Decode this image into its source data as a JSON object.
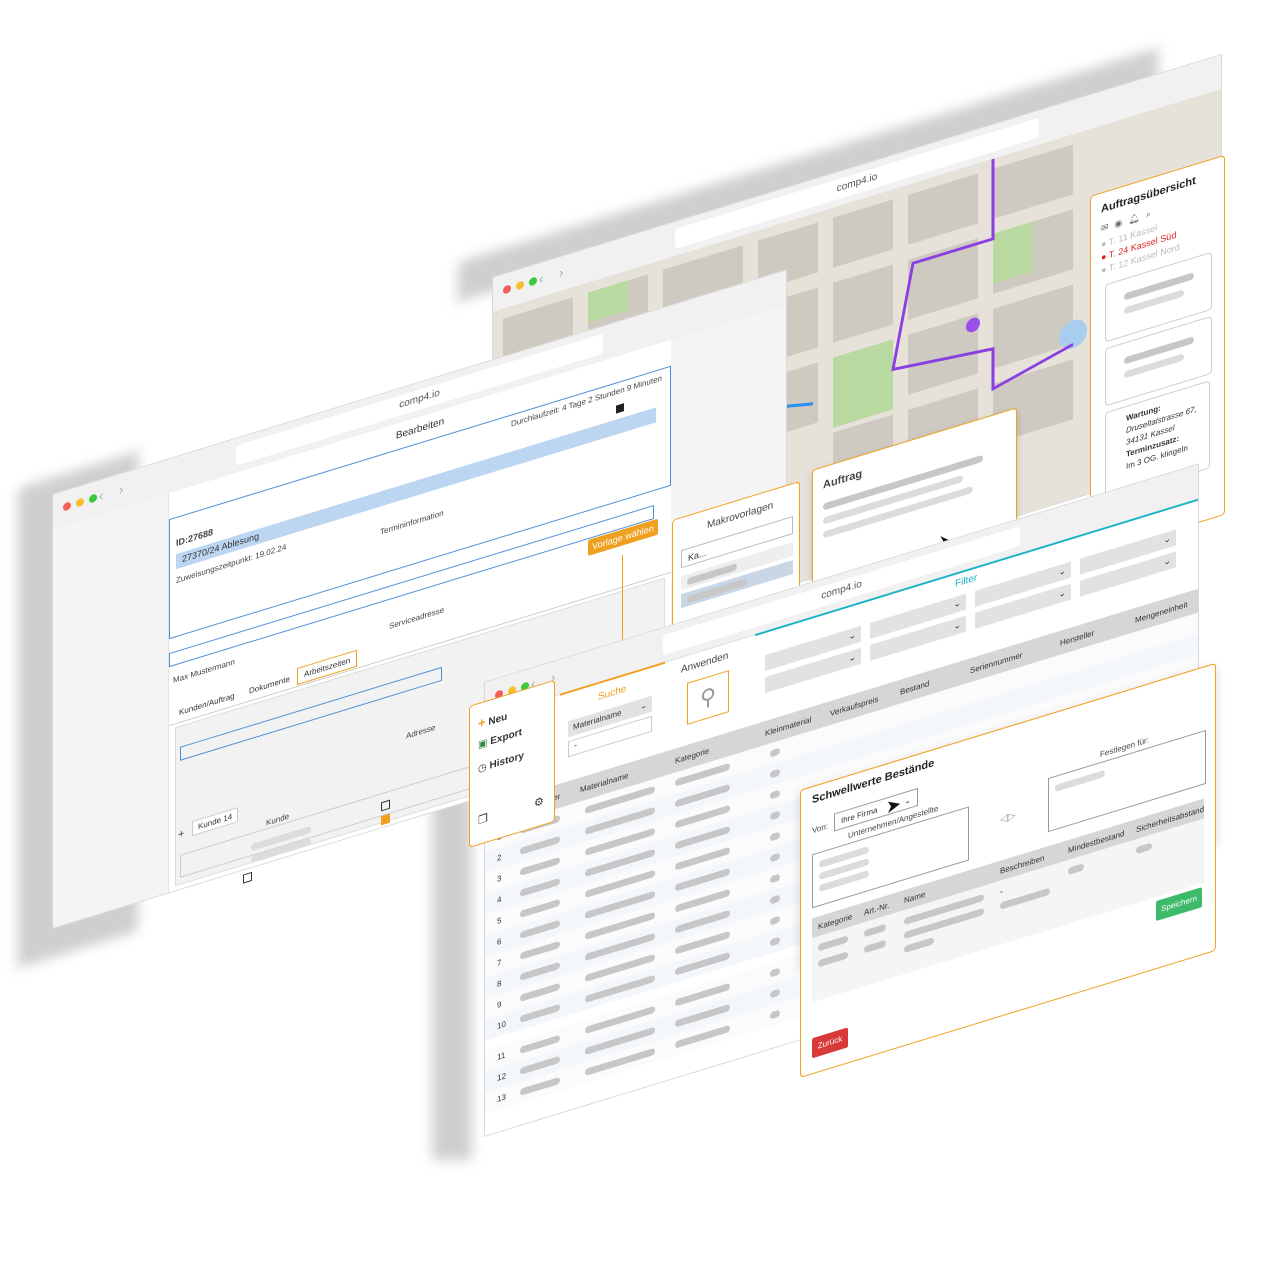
{
  "url": "comp4.io",
  "order_window": {
    "url": "comp4.io",
    "edit_header": "Bearbeiten",
    "throughput": "Durchlaufzeit: 4 Tage 2 Stunden 9 Minuten",
    "order_id": "ID:27688",
    "selected_entry": "27370/24 Ablesung",
    "assignment_time": "Zuweisungszeitpunkt: 19.02.24",
    "appointment_info": "Termininformation",
    "template_button": "Vorlage wählen",
    "customer_name": "Max Mustermann",
    "service_address": "Serviceadresse",
    "tabs": [
      "Kunden/Auftrag",
      "Dokumente",
      "Arbeitszeiten"
    ],
    "address_label": "Adresse",
    "customer_tag": "Kunde 14",
    "customer_label": "Kunde",
    "add_symbol": "+"
  },
  "macro_panel": {
    "title": "Makrovorlagen",
    "input_value": "Ka..."
  },
  "map_window": {
    "url": "comp4.io",
    "overview_title": "Auftragsübersicht",
    "locations": [
      {
        "label": "T. 11 Kassel",
        "color": "#bbbbbb"
      },
      {
        "label": "T. 24 Kassel Süd",
        "color": "#e02020"
      },
      {
        "label": "T. 12 Kassel Nord",
        "color": "#bbbbbb"
      }
    ],
    "maintenance": {
      "label": "Wartung:",
      "street": "Druseltalstrasse 67,",
      "city": "34131 Kassel",
      "extra_label": "Terminzusatz:",
      "extra_value": "Im 3 OG. klingeln"
    },
    "order_popup_title": "Auftrag"
  },
  "inventory_window": {
    "url": "comp4.io",
    "menu": [
      {
        "label": "Neu",
        "icon": "plus-icon"
      },
      {
        "label": "Export",
        "icon": "excel-icon"
      },
      {
        "label": "History",
        "icon": "clock-icon"
      }
    ],
    "search_title": "Suche",
    "search_select": "Materialname",
    "search_value": "-",
    "apply_title": "Anwenden",
    "filter_title": "Filter",
    "columns": [
      "Materialname",
      "Kategorie",
      "Kleinmaterial",
      "Verkaufspreis",
      "Bestand",
      "Seriennummer",
      "Hersteller",
      "Mengeneinheit"
    ],
    "column_partial": "mmer",
    "row_numbers": [
      "1",
      "2",
      "3",
      "4",
      "5",
      "6",
      "7",
      "8",
      "9",
      "10",
      "11",
      "12",
      "13"
    ],
    "hersteller_dash": "-"
  },
  "threshold_dialog": {
    "title": "Schwellwerte Bestände",
    "from_label": "Von:",
    "from_value": "Ihre Firma",
    "users_label": "Unternehmen/Angestellte",
    "set_for_label": "Festlegen für:",
    "columns": [
      "Kategorie",
      "Art.-Nr.",
      "Name",
      "Beschreiben",
      "Mindestbestand",
      "Sicherheitsabstand"
    ],
    "dash": "-",
    "save_button": "Speichern",
    "back_button": "Zurück"
  },
  "colors": {
    "accent_orange": "#f0a020",
    "filter_teal": "#19b3c7",
    "save_green": "#3dbb6b",
    "back_red": "#d83a3a",
    "selection_blue": "#bcd6f2",
    "route_purple": "#8a3fe0",
    "route_blue": "#2a8ff0"
  }
}
